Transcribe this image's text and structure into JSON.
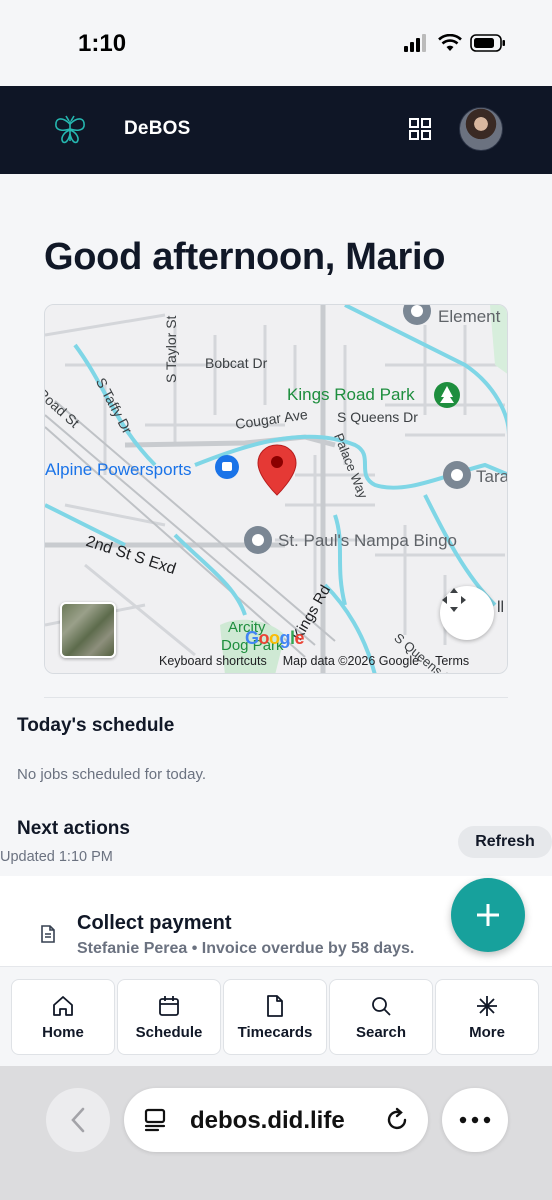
{
  "status_bar": {
    "time": "1:10"
  },
  "header": {
    "app_name": "DeBOS",
    "brand_color": "#0f1626"
  },
  "greeting": "Good afternoon, Mario",
  "map": {
    "labels": {
      "element": "Element",
      "s_taylor": "S Taylor St",
      "bobcat": "Bobcat Dr",
      "s_taffy": "S Taffy Dr",
      "road_st": "Road St",
      "kings_road_park": "Kings Road Park",
      "cougar": "Cougar Ave",
      "s_queens_dr": "S Queens Dr",
      "palace_way": "Palace Way",
      "alpine": "Alpine Powersports",
      "tara": "Tara",
      "second_st": "2nd St S Exd",
      "st_pauls": "St. Paul's Nampa Bingo",
      "kings_rd": "Kings Rd",
      "arcity": "Arcity",
      "dog_park": "Dog Park",
      "s_queens_dr2": "S Queens Dr",
      "ll": "ll"
    },
    "google": "Google",
    "footer": {
      "shortcuts": "Keyboard shortcuts",
      "map_data": "Map data ©2026 Google",
      "terms": "Terms"
    }
  },
  "schedule": {
    "title": "Today's schedule",
    "empty": "No jobs scheduled for today."
  },
  "next_actions": {
    "title": "Next actions",
    "updated": "Updated 1:10 PM",
    "refresh_label": "Refresh",
    "items": [
      {
        "title": "Collect payment",
        "subtitle": "Stefanie Perea • Invoice overdue by 58 days."
      }
    ]
  },
  "fab": {
    "symbol": "+",
    "color": "#17a19c"
  },
  "nav": [
    {
      "label": "Home",
      "icon": "home-icon"
    },
    {
      "label": "Schedule",
      "icon": "calendar-icon"
    },
    {
      "label": "Timecards",
      "icon": "file-icon"
    },
    {
      "label": "Search",
      "icon": "search-icon"
    },
    {
      "label": "More",
      "icon": "asterisk-icon"
    }
  ],
  "browser": {
    "url": "debos.did.life"
  }
}
